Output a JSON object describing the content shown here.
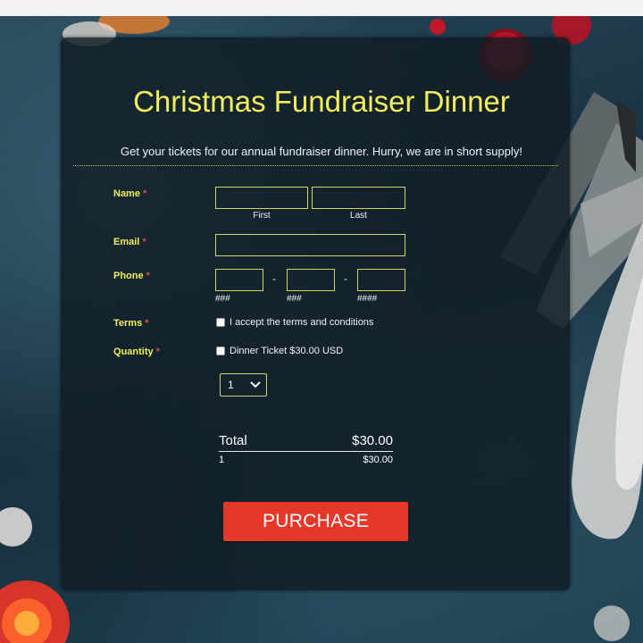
{
  "form": {
    "title": "Christmas Fundraiser Dinner",
    "subtitle": "Get your tickets for our annual fundraiser dinner. Hurry, we are in short supply!",
    "required_marker": "*",
    "name": {
      "label": "Name",
      "first_sublabel": "First",
      "last_sublabel": "Last",
      "first_value": "",
      "last_value": ""
    },
    "email": {
      "label": "Email",
      "value": ""
    },
    "phone": {
      "label": "Phone",
      "dash": "-",
      "area_hint": "###",
      "prefix_hint": "###",
      "line_hint": "####"
    },
    "terms": {
      "label": "Terms",
      "checkbox_label": "I accept the terms and conditions",
      "checked": false
    },
    "quantity": {
      "label": "Quantity",
      "checkbox_label": "Dinner Ticket $30.00 USD",
      "checked": false,
      "selected": "1"
    },
    "summary": {
      "total_label": "Total",
      "total_value": "$30.00",
      "line_qty": "1",
      "line_amount": "$30.00"
    },
    "purchase_label": "PURCHASE"
  },
  "colors": {
    "title": "#f3ef5a",
    "labels": "#f3ef5a",
    "required": "#e24a3b",
    "button": "#e5382a",
    "field_border": "#d6d35e"
  }
}
